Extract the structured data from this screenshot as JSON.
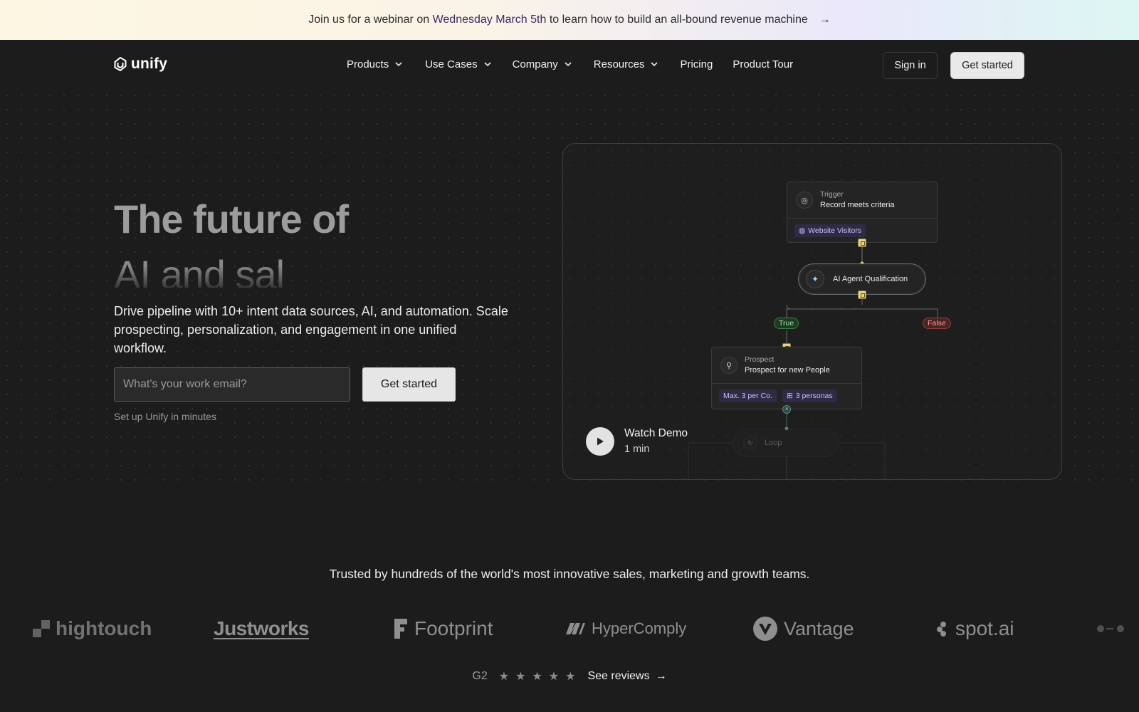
{
  "banner": {
    "text_before": "Join us for a webinar on",
    "highlight": "Wednesday March 5th",
    "text_after": "to learn how to build an all-bound revenue machine",
    "arrow_icon": "arrow-right-icon"
  },
  "nav": {
    "logo_text": "unify",
    "menu": {
      "products": "Products",
      "use_cases": "Use Cases",
      "company": "Company",
      "resources": "Resources",
      "pricing": "Pricing",
      "product_tour": "Product Tour"
    },
    "sign_in": "Sign in",
    "get_started": "Get started"
  },
  "hero": {
    "title": "The future of",
    "rotating_text": "AI and sal",
    "description": "Drive pipeline with 10+ intent data sources, AI, and automation. Scale prospecting, personalization, and engagement in one unified workflow.",
    "email_placeholder": "What's your work email?",
    "cta": "Get started",
    "note": "Set up Unify in minutes"
  },
  "demo": {
    "trigger": {
      "kind": "Trigger",
      "desc": "Record meets criteria",
      "chip": "Website Visitors"
    },
    "ai_node": "AI Agent Qualification",
    "branch_true": "True",
    "branch_false": "False",
    "prospect": {
      "kind": "Prospect",
      "desc": "Prospect for new People",
      "chip1": "Max. 3 per Co.",
      "chip2": "3 personas"
    },
    "loop": "Loop",
    "watch_title": "Watch Demo",
    "watch_duration": "1 min"
  },
  "trusted": {
    "heading": "Trusted by hundreds of the world's most innovative sales, marketing and growth teams.",
    "logos": {
      "hightouch": "hightouch",
      "justworks": "Justworks",
      "footprint": "Footprint",
      "hypercomply": "HyperComply",
      "vantage": "Vantage",
      "spotai": "spot.ai"
    }
  },
  "reviews": {
    "g2": "G2",
    "rating_stars": 5,
    "link": "See reviews"
  },
  "colors": {
    "background": "#1c1c1c",
    "accent_chip": "#2f2b45",
    "true_green": "#9fe0a4",
    "false_red": "#ff9b9b",
    "connector_yellow": "#e6d28a"
  }
}
